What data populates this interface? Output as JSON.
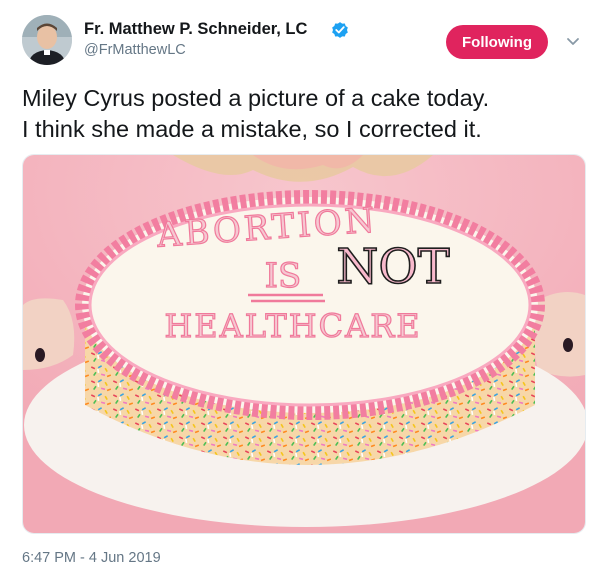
{
  "author": {
    "name": "Fr. Matthew P. Schneider, LC",
    "handle": "@FrMatthewLC",
    "verified": true
  },
  "follow_button": {
    "label": "Following",
    "color": "#e0245e"
  },
  "menu": {
    "icon": "chevron-down-icon"
  },
  "tweet": {
    "lines": [
      "Miley Cyrus posted a picture of a cake today.",
      "I think she made a mistake, so I corrected it."
    ]
  },
  "media": {
    "cake_text": {
      "line1": "ABORTION",
      "line2": "IS",
      "inserted": "NOT",
      "line3": "HEALTHCARE"
    },
    "colors": {
      "background": "#f4b7c1",
      "frosting": "#fbf6ec",
      "piping": "#f27ea0",
      "platter": "#f7f2ee"
    }
  },
  "timestamp": "6:47 PM - 4 Jun 2019"
}
